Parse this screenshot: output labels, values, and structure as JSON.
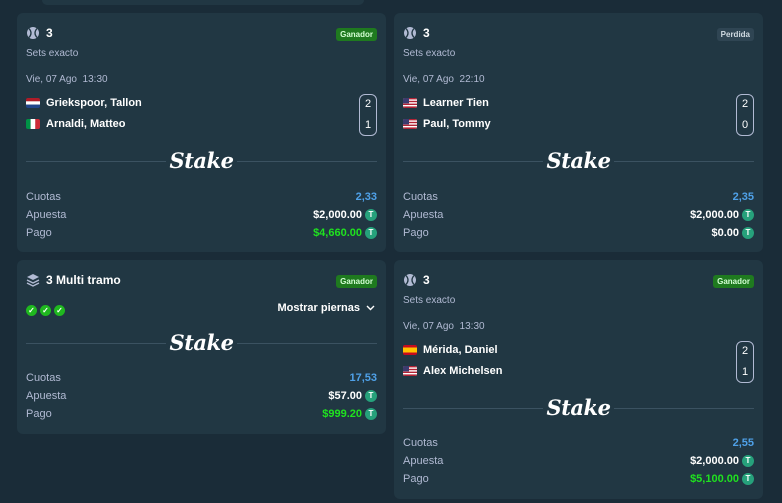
{
  "colors": {
    "background": "#1a2c38",
    "card": "#213743",
    "win_badge": "#1f7a1f",
    "lose_badge": "#2f4553",
    "odds_blue": "#4fa1e8",
    "payout_green": "#1fe21f",
    "tether": "#26a17b"
  },
  "logo_text": "Stake",
  "currency_symbol": "T",
  "labels": {
    "odds": "Cuotas",
    "stake": "Apuesta",
    "payout": "Pago"
  },
  "bets": [
    {
      "count": "3",
      "icon": "tennis-ball-icon",
      "status": "Ganador",
      "market": "Sets exacto",
      "date": "Vie, 07 Ago",
      "time": "13:30",
      "players": [
        {
          "name": "Griekspoor, Tallon",
          "flag": "netherlands-flag-icon",
          "score": "2"
        },
        {
          "name": "Arnaldi, Matteo",
          "flag": "italy-flag-icon",
          "score": "1"
        }
      ],
      "odds": "2,33",
      "stake": "$2,000.00",
      "payout": "$4,660.00"
    },
    {
      "count": "3",
      "icon": "tennis-ball-icon",
      "status": "Perdida",
      "market": "Sets exacto",
      "date": "Vie, 07 Ago",
      "time": "22:10",
      "players": [
        {
          "name": "Learner Tien",
          "flag": "usa-flag-icon",
          "score": "2"
        },
        {
          "name": "Paul, Tommy",
          "flag": "usa-flag-icon",
          "score": "0"
        }
      ],
      "odds": "2,35",
      "stake": "$2,000.00",
      "payout": "$0.00"
    },
    {
      "count": "3",
      "title": "Multi tramo",
      "icon": "layers-icon",
      "status": "Ganador",
      "show_legs": "Mostrar piernas",
      "checks": 3,
      "odds": "17,53",
      "stake": "$57.00",
      "payout": "$999.20"
    },
    {
      "count": "3",
      "icon": "tennis-ball-icon",
      "status": "Ganador",
      "market": "Sets exacto",
      "date": "Vie, 07 Ago",
      "time": "13:30",
      "players": [
        {
          "name": "Mérida, Daniel",
          "flag": "spain-flag-icon",
          "score": "2"
        },
        {
          "name": "Alex Michelsen",
          "flag": "usa-flag-icon",
          "score": "1"
        }
      ],
      "odds": "2,55",
      "stake": "$2,000.00",
      "payout": "$5,100.00"
    }
  ]
}
